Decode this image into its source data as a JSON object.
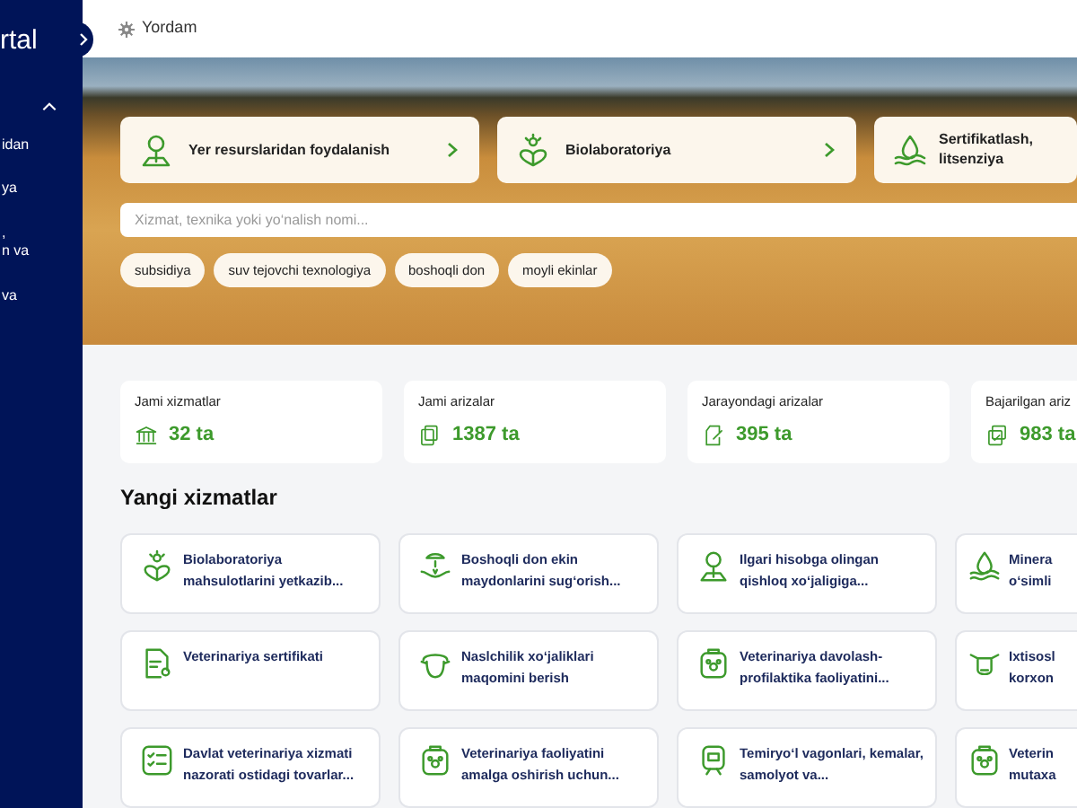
{
  "sidebar": {
    "logo": "rtal",
    "items": [
      {
        "label": "idan"
      },
      {
        "label": "ya"
      },
      {
        "label": ",\nn va"
      },
      {
        "label": "va"
      }
    ]
  },
  "topbar": {
    "help": "Yordam"
  },
  "hero": {
    "categories": [
      {
        "label": "Yer resurslaridan foydalanish"
      },
      {
        "label": "Biolaboratoriya"
      },
      {
        "label": "Sertifikatlash, litsenziya"
      }
    ],
    "search": {
      "placeholder": "Xizmat, texnika yoki yo‘nalish nomi..."
    },
    "chips": [
      "subsidiya",
      "suv tejovchi texnologiya",
      "boshoqli don",
      "moyli ekinlar"
    ]
  },
  "stats": [
    {
      "label": "Jami xizmatlar",
      "value": "32 ta"
    },
    {
      "label": "Jami arizalar",
      "value": "1387 ta"
    },
    {
      "label": "Jarayondagi arizalar",
      "value": "395 ta"
    },
    {
      "label": "Bajarilgan ariz",
      "value": "983 ta"
    }
  ],
  "section_title": "Yangi xizmatlar",
  "services": [
    {
      "label": "Biolaboratoriya mahsulotlarini yetkazib..."
    },
    {
      "label": "Boshoqli don ekin maydonlarini sug‘orish..."
    },
    {
      "label": "Ilgari hisobga olingan qishloq xo‘jaligiga..."
    },
    {
      "label": "Minera\no‘simli"
    },
    {
      "label": "Veterinariya sertifikati"
    },
    {
      "label": "Naslchilik xo‘jaliklari maqomini berish"
    },
    {
      "label": "Veterinariya davolash-profilaktika faoliyatini..."
    },
    {
      "label": "Ixtisosl\nkorxon"
    },
    {
      "label": "Davlat veterinariya xizmati nazorati ostidagi tovarlar..."
    },
    {
      "label": "Veterinariya faoliyatini amalga oshirish uchun..."
    },
    {
      "label": "Temiryo‘l vagonlari, kemalar, samolyot va..."
    },
    {
      "label": "Veterin\nmutaxa"
    }
  ]
}
